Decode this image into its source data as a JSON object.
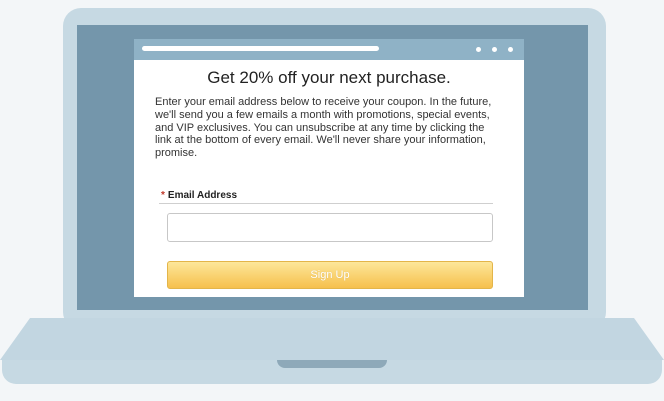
{
  "popup": {
    "title": "Get 20% off your next purchase.",
    "body": "Enter your email address below to receive your coupon. In the future, we'll send you a few emails a month with promotions, special events, and VIP exclusives. You can unsubscribe at any time by clicking the link at the bottom of every email. We'll never share your information, promise.",
    "email_label": "Email Address",
    "required_marker": "*",
    "email_value": "",
    "submit_label": "Sign Up"
  },
  "browser": {
    "controls": [
      "dot",
      "dot",
      "dot"
    ]
  },
  "colors": {
    "screen": "#7496ab",
    "browser_bar": "#8fb2c6",
    "laptop_body": "#c6d9e3",
    "button_gradient_top": "#fde79a",
    "button_gradient_bottom": "#f6c04d",
    "required_star": "#c0392b"
  }
}
